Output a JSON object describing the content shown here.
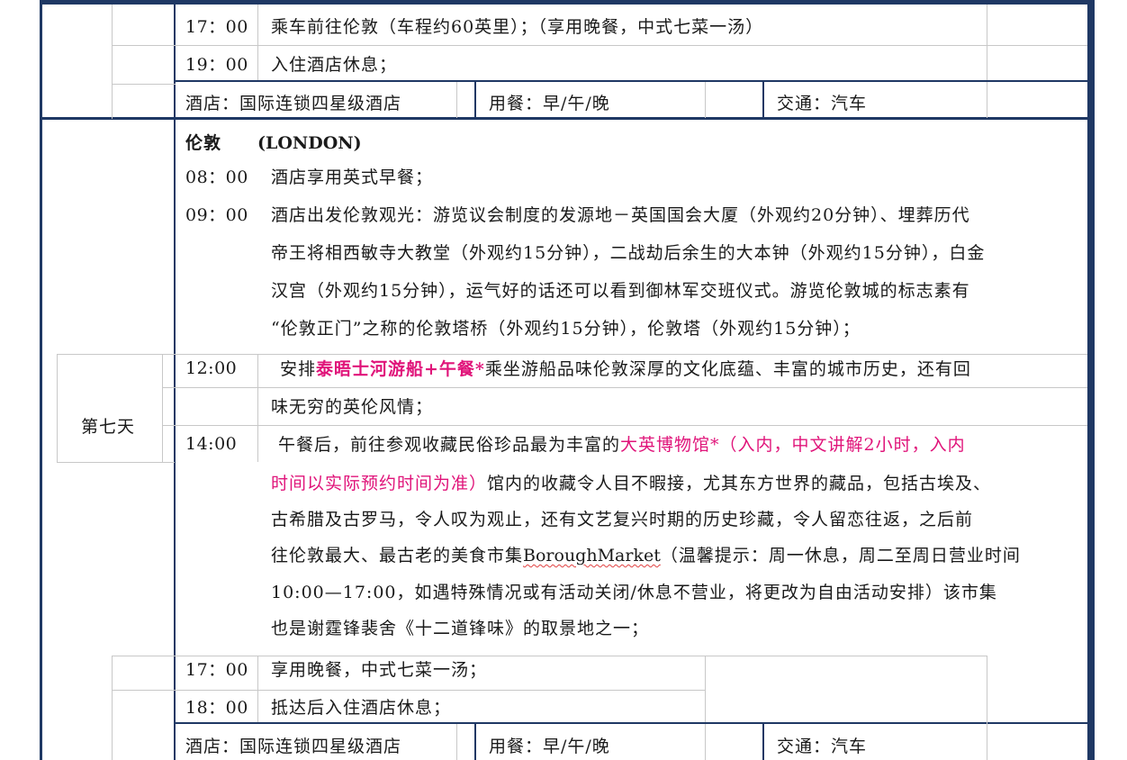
{
  "day6_tail": {
    "rows": [
      {
        "time": "17：00",
        "text": "乘车前往伦敦（车程约60英里）；（享用晚餐，中式七菜一汤）"
      },
      {
        "time": "19：00",
        "text": "入住酒店休息；"
      }
    ],
    "footer": {
      "hotel": "酒店：国际连锁四星级酒店",
      "meal": "用餐：早/午/晚",
      "transport": "交通：汽车"
    }
  },
  "day7": {
    "label": "第七天",
    "city": "伦敦",
    "city_en": "(LONDON)",
    "items": [
      {
        "time": "08：00",
        "lines": [
          "酒店享用英式早餐；"
        ]
      },
      {
        "time": "09：00",
        "lines": [
          "酒店出发伦敦观光：游览议会制度的发源地－英国国会大厦（外观约20分钟）、埋葬历代",
          "帝王将相西敏寺大教堂（外观约15分钟），二战劫后余生的大本钟（外观约15分钟），白金",
          "汉宫（外观约15分钟），运气好的话还可以看到御林军交班仪式。游览伦敦城的标志素有",
          "“伦敦正门”之称的伦敦塔桥（外观约15分钟），伦敦塔（外观约15分钟）；"
        ]
      },
      {
        "time": "12:00",
        "pre": "安排",
        "highlight": "泰晤士河游船+午餐*",
        "post": "乘坐游船品味伦敦深厚的文化底蕴、丰富的城市历史，还有回",
        "line2": "味无穷的英伦风情；"
      },
      {
        "time": "14:00",
        "pre": "午餐后，前往参观收藏民俗珍品最为丰富的",
        "highlight1": "大英博物馆*（入内，中文讲解2小时，入内",
        "highlight2": "时间以实际预约时间为准）",
        "line2_rest": "馆内的收藏令人目不暇接，尤其东方世界的藏品，包括古埃及、",
        "line3": "古希腊及古罗马，令人叹为观止，还有文艺复兴时期的历史珍藏，令人留恋往返，之后前",
        "line4_pre": "往伦敦最大、最古老的美食市集",
        "line4_market": "BoroughMarket",
        "line4_post": "（温馨提示：周一休息，周二至周日营业时间",
        "line5": "10:00—17:00，如遇特殊情况或有活动关闭/休息不营业，将更改为自由活动安排）该市集",
        "line6": "也是谢霆锋裴舍《十二道锋味》的取景地之一；"
      },
      {
        "time": "17：00",
        "lines": [
          "享用晚餐，中式七菜一汤；"
        ]
      },
      {
        "time": "18：00",
        "lines": [
          "抵达后入住酒店休息；"
        ]
      }
    ],
    "footer": {
      "hotel": "酒店：国际连锁四星级酒店",
      "meal": "用餐：早/午/晚",
      "transport": "交通：汽车"
    }
  },
  "colors": {
    "border": "#1f3864",
    "highlight": "#e0147a",
    "grid": "#c8c8c8"
  }
}
